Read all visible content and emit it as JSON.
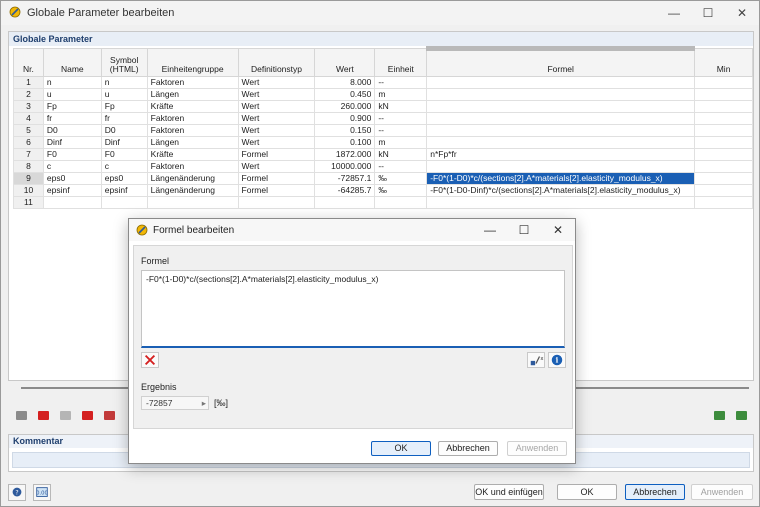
{
  "window": {
    "title": "Globale Parameter bearbeiten",
    "controls": [
      "—",
      "☐",
      "✕"
    ]
  },
  "params_panel": {
    "title": "Globale Parameter",
    "columns": [
      "Nr.",
      "Name",
      "Symbol\n(HTML)",
      "Einheitengruppe",
      "Definitionstyp",
      "Wert",
      "Einheit",
      "Formel",
      "Min"
    ],
    "rows": [
      {
        "nr": "1",
        "name": "n",
        "symbol": "n",
        "group": "Faktoren",
        "type": "Wert",
        "value": "8.000",
        "unit": "--",
        "formula": ""
      },
      {
        "nr": "2",
        "name": "u",
        "symbol": "u",
        "group": "Längen",
        "type": "Wert",
        "value": "0.450",
        "unit": "m",
        "formula": ""
      },
      {
        "nr": "3",
        "name": "Fp",
        "symbol": "Fp",
        "group": "Kräfte",
        "type": "Wert",
        "value": "260.000",
        "unit": "kN",
        "formula": ""
      },
      {
        "nr": "4",
        "name": "fr",
        "symbol": "fr",
        "group": "Faktoren",
        "type": "Wert",
        "value": "0.900",
        "unit": "--",
        "formula": ""
      },
      {
        "nr": "5",
        "name": "D0",
        "symbol": "D0",
        "group": "Faktoren",
        "type": "Wert",
        "value": "0.150",
        "unit": "--",
        "formula": ""
      },
      {
        "nr": "6",
        "name": "Dinf",
        "symbol": "Dinf",
        "group": "Längen",
        "type": "Wert",
        "value": "0.100",
        "unit": "m",
        "formula": ""
      },
      {
        "nr": "7",
        "name": "F0",
        "symbol": "F0",
        "group": "Kräfte",
        "type": "Formel",
        "value": "1872.000",
        "unit": "kN",
        "formula": "n*Fp*fr"
      },
      {
        "nr": "8",
        "name": "c",
        "symbol": "c",
        "group": "Faktoren",
        "type": "Wert",
        "value": "10000.000",
        "unit": "--",
        "formula": ""
      },
      {
        "nr": "9",
        "name": "eps0",
        "symbol": "eps0",
        "group": "Längenänderung",
        "type": "Formel",
        "value": "-72857.1",
        "unit": "‰",
        "formula": "-F0*(1-D0)*c/(sections[2].A*materials[2].elasticity_modulus_x)"
      },
      {
        "nr": "10",
        "name": "epsinf",
        "symbol": "epsinf",
        "group": "Längenänderung",
        "type": "Formel",
        "value": "-64285.7",
        "unit": "‰",
        "formula": "-F0*(1-D0-Dinf)*c/(sections[2].A*materials[2].elasticity_modulus_x)"
      },
      {
        "nr": "11",
        "name": "",
        "symbol": "",
        "group": "",
        "type": "",
        "value": "",
        "unit": "",
        "formula": ""
      }
    ]
  },
  "comment_panel": {
    "title": "Kommentar"
  },
  "footer": {
    "ok_insert": "OK und einfügen",
    "ok": "OK",
    "cancel": "Abbrechen",
    "apply": "Anwenden"
  },
  "dialog": {
    "title": "Formel bearbeiten",
    "formula_label": "Formel",
    "formula": "-F0*(1-D0)*c/(sections[2].A*materials[2].elasticity_modulus_x)",
    "result_label": "Ergebnis",
    "result_value": "-72857",
    "result_unit": "[‰]",
    "ok": "OK",
    "cancel": "Abbrechen",
    "apply": "Anwenden"
  },
  "colors": {
    "accent": "#1a5fb4",
    "panel_title": "#1f3f6e",
    "delete_red": "#d42020"
  }
}
